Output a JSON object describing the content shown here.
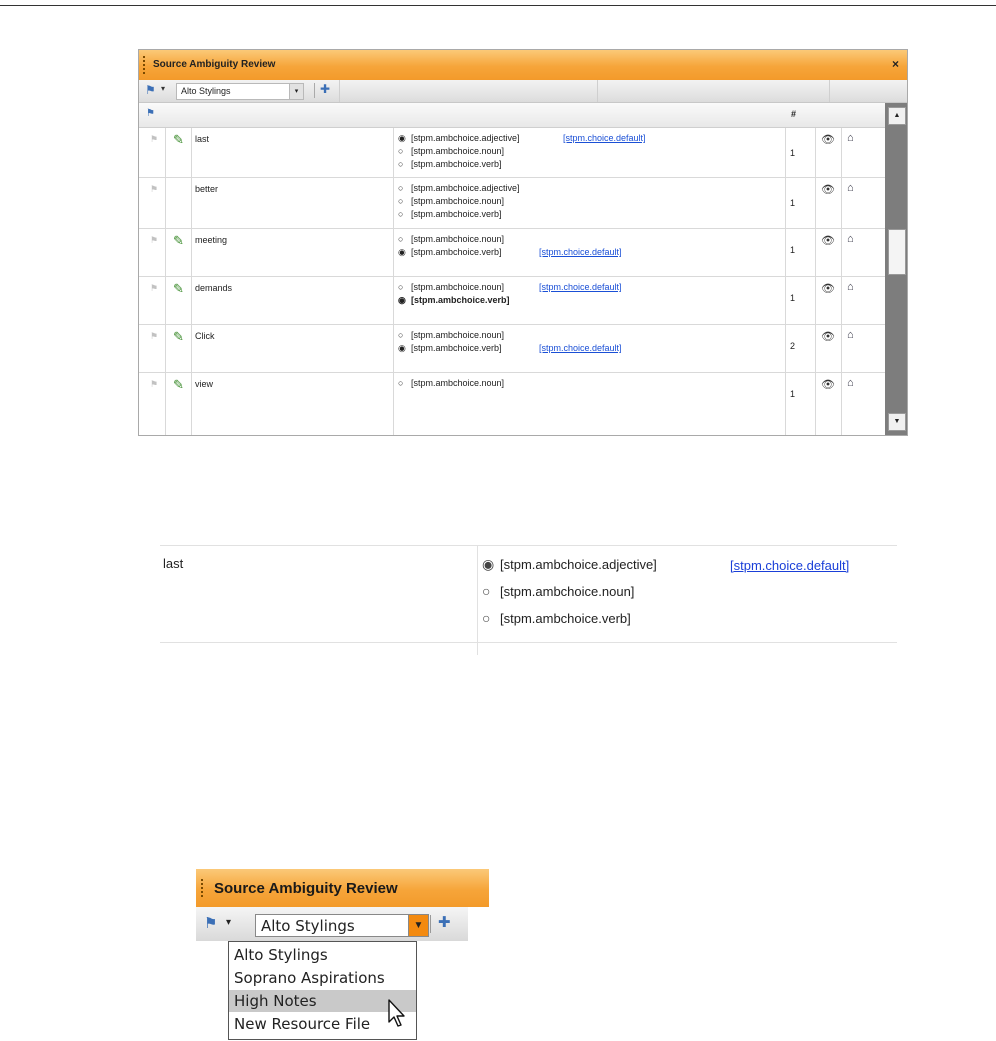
{
  "panel": {
    "title": "Source Ambiguity Review",
    "close_glyph": "×",
    "toolbar": {
      "flag_icon": "flag-icon",
      "caret": "▾",
      "resource_selected": "Alto Stylings",
      "select_arrow": "▾",
      "save_icon": "save-icon",
      "save_glyph": "✚"
    },
    "grid": {
      "count_header": "#",
      "rows": [
        {
          "word": "last",
          "has_icon": true,
          "count": "1",
          "options": [
            {
              "label": "[stpm.ambchoice.adjective]",
              "checked": true,
              "default": "[stpm.choice.default]"
            },
            {
              "label": "[stpm.ambchoice.noun]",
              "checked": false
            },
            {
              "label": "[stpm.ambchoice.verb]",
              "checked": false
            }
          ]
        },
        {
          "word": "better",
          "has_icon": false,
          "count": "1",
          "options": [
            {
              "label": "[stpm.ambchoice.adjective]",
              "checked": false
            },
            {
              "label": "[stpm.ambchoice.noun]",
              "checked": false
            },
            {
              "label": "[stpm.ambchoice.verb]",
              "checked": false
            }
          ]
        },
        {
          "word": "meeting",
          "has_icon": true,
          "count": "1",
          "options": [
            {
              "label": "[stpm.ambchoice.noun]",
              "checked": false
            },
            {
              "label": "[stpm.ambchoice.verb]",
              "checked": true,
              "default": "[stpm.choice.default]"
            }
          ]
        },
        {
          "word": "demands",
          "has_icon": true,
          "count": "1",
          "options": [
            {
              "label": "[stpm.ambchoice.noun]",
              "checked": false,
              "default": "[stpm.choice.default]"
            },
            {
              "label": "[stpm.ambchoice.verb]",
              "checked": true,
              "bold": true
            }
          ]
        },
        {
          "word": "Click",
          "has_icon": true,
          "count": "2",
          "options": [
            {
              "label": "[stpm.ambchoice.noun]",
              "checked": false
            },
            {
              "label": "[stpm.ambchoice.verb]",
              "checked": true,
              "default": "[stpm.choice.default]"
            }
          ]
        },
        {
          "word": "view",
          "has_icon": true,
          "count": "1",
          "options": [
            {
              "label": "[stpm.ambchoice.noun]",
              "checked": false
            }
          ]
        }
      ]
    }
  },
  "zoom": {
    "word": "last",
    "options": [
      {
        "label": "[stpm.ambchoice.adjective]",
        "checked": true
      },
      {
        "label": "[stpm.ambchoice.noun]",
        "checked": false
      },
      {
        "label": "[stpm.ambchoice.verb]",
        "checked": false
      }
    ],
    "default_link": "[stpm.choice.default]"
  },
  "dropdown_panel": {
    "title": "Source Ambiguity Review",
    "selected": "Alto Stylings",
    "options": [
      "Alto Stylings",
      "Soprano Aspirations",
      "High Notes",
      "New Resource File"
    ],
    "highlighted": "High Notes"
  },
  "colors": {
    "title_orange": "#f6a53a",
    "link_blue": "#1a4fd6",
    "dropdown_arrow": "#f38a10"
  },
  "icons": {
    "radio_on": "◉",
    "radio_off": "○",
    "binoculars": "binoculars-icon",
    "resource": "resource-icon",
    "resolved": "resolved-icon"
  }
}
